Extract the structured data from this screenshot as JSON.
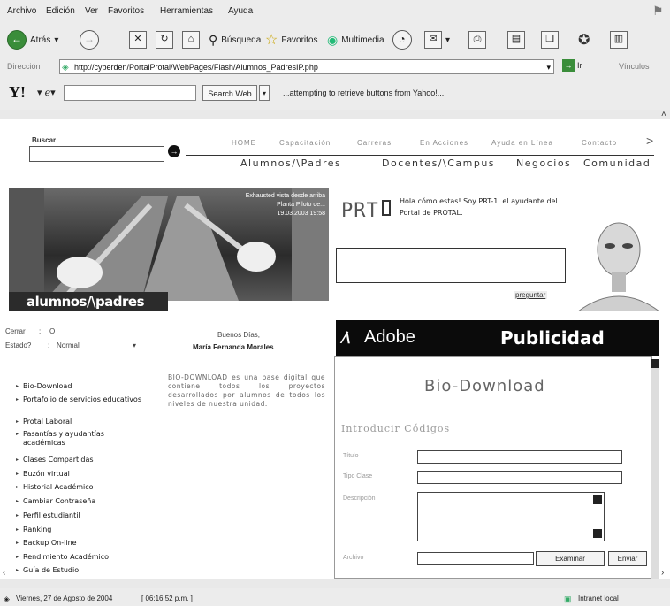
{
  "menubar": {
    "items": [
      "Archivo",
      "Edición",
      "Ver",
      "Favoritos",
      "Herramientas",
      "Ayuda"
    ]
  },
  "toolbar": {
    "back_label": "Atrás",
    "search_label": "Búsqueda",
    "favorites_label": "Favoritos",
    "multimedia_label": "Multimedia"
  },
  "address": {
    "label": "Dirección",
    "url": "http://cyberden/PortalProtal/WebPages/Flash/Alumnos_PadresIP.php",
    "go_label": "Ir",
    "links_label": "Vínculos"
  },
  "yahoo_bar": {
    "search_button": "Search Web",
    "status": "...attempting to retrieve buttons from Yahoo!..."
  },
  "site": {
    "search_label": "Buscar",
    "nav_top": [
      "HOME",
      "Capacitación",
      "Carreras",
      "En Acciones",
      "Ayuda en Línea",
      "Contacto"
    ],
    "nav_bottom": [
      "Alumnos/\\Padres",
      "Docentes/\\Campus",
      "Negocios",
      "Comunidad"
    ],
    "banner_caption": [
      "Exhausted vista desde arriba",
      "Planta Piloto de...",
      "19.03.2003 19:58"
    ],
    "banner_title": "alumnos/\\padres",
    "assistant_logo": "PRT",
    "assistant_text": "Hola cómo estas! Soy PRT-1, el ayudante del Portal de PROTAL.",
    "ask_button": "preguntar",
    "session": {
      "close_label": "Cerrar",
      "close_value": "O",
      "state_label": "Estado?",
      "state_value": "Normal",
      "greeting": "Buenos Días,",
      "user": "María Fernanda Morales"
    },
    "sidebar_items": [
      "Bio-Download",
      "Portafolio de servicios educativos",
      "Protal Laboral",
      "Pasantías y ayudantías académicas",
      "Clases Compartidas",
      "Buzón virtual",
      "Historial Académico",
      "Cambiar Contraseña",
      "Perfil estudiantil",
      "Ranking",
      "Backup On-line",
      "Rendimiento Académico",
      "Guía de Estudio"
    ],
    "description": "BIO-DOWNLOAD es una base digital que contiene todos los proyectos desarrollados por alumnos de todos los niveles de nuestra unidad.",
    "ad_brand": "Adobe",
    "ad_title": "Publicidad",
    "form": {
      "title": "Bio-Download",
      "section": "Introducir Códigos",
      "field1": "Título",
      "field2": "Tipo Clase",
      "field3": "Descripción",
      "field4": "Archivo",
      "browse": "Examinar",
      "send": "Enviar"
    }
  },
  "statusbar": {
    "date": "Viernes, 27 de Agosto de 2004",
    "time": "[ 06:16:52 p.m. ]",
    "zone": "Intranet local"
  }
}
